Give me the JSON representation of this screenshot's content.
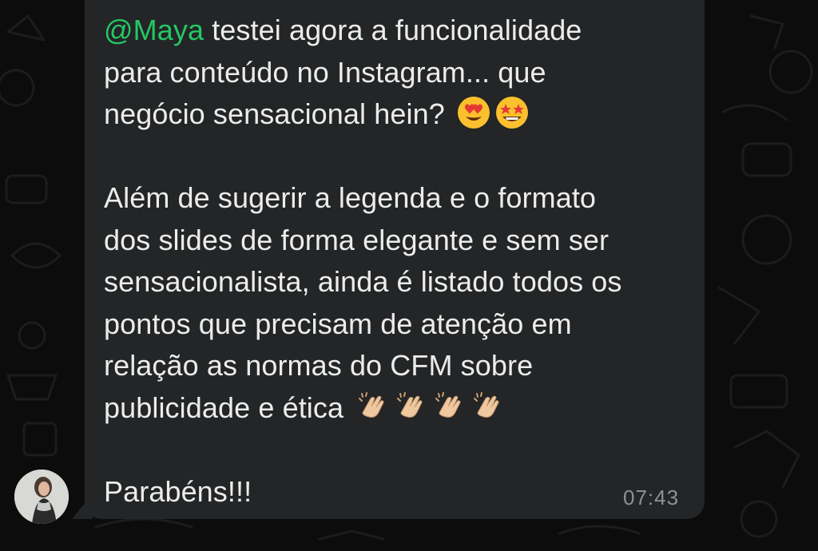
{
  "message": {
    "mention_at": "@",
    "mention_name": "Maya",
    "line1_rest": " testei agora a funcionalidade",
    "line2": "para conteúdo no Instagram... que",
    "line3": "negócio sensacional hein?",
    "line4": "Além de sugerir a legenda e o formato",
    "line5": "dos slides de forma elegante e sem ser",
    "line6": "sensacionalista, ainda é listado todos os",
    "line7": "pontos que precisam de atenção em",
    "line8": "relação as normas do CFM sobre",
    "line9": "publicidade e ética",
    "line10": "Parabéns!!!",
    "emojis_line3": [
      "heart-eyes-emoji",
      "star-struck-emoji"
    ],
    "emojis_line9": [
      "clapping-hands-emoji",
      "clapping-hands-emoji",
      "clapping-hands-emoji",
      "clapping-hands-emoji"
    ],
    "timestamp": "07:43"
  },
  "colors": {
    "bubble": "#232526",
    "mention": "#25c765",
    "text": "#ececec",
    "timestamp": "#8e9194",
    "background": "#0c0c0c"
  },
  "sender": {
    "avatar": "avatar-photo"
  }
}
